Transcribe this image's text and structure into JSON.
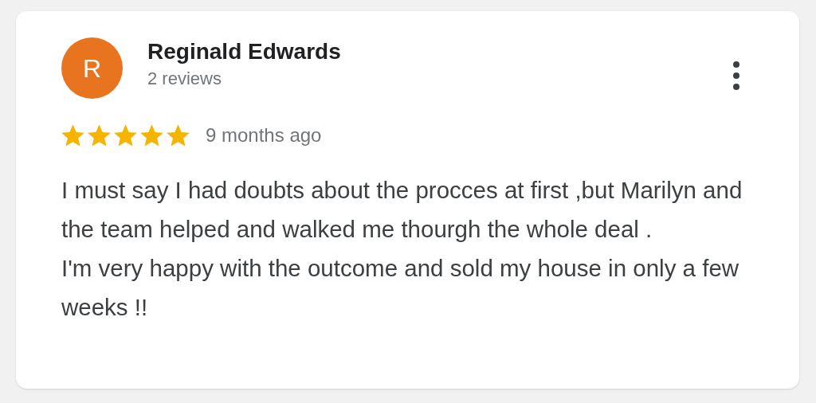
{
  "review": {
    "avatar_letter": "R",
    "author": "Reginald Edwards",
    "review_count": "2 reviews",
    "stars": 5,
    "time": "9 months ago",
    "paragraphs": [
      "I must say I had doubts about the procces at first ,but Marilyn and the team helped and walked me thourgh the whole deal .",
      "I'm very happy with the outcome and sold my house in only a few weeks !!"
    ]
  }
}
